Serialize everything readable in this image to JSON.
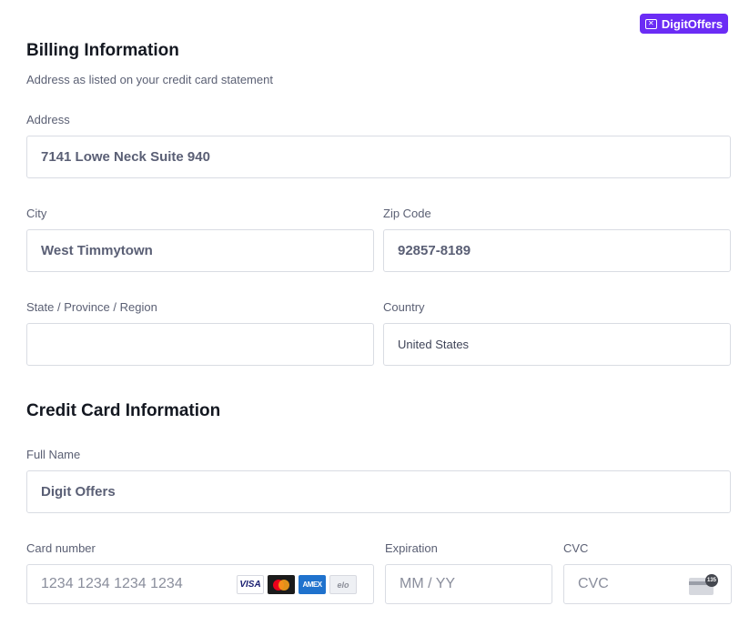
{
  "brand": {
    "name": "DigitOffers",
    "icon": "ticket-icon",
    "color": "#6b2cf5"
  },
  "billing": {
    "title": "Billing Information",
    "subtitle": "Address as listed on your credit card statement",
    "address": {
      "label": "Address",
      "value": "7141 Lowe Neck Suite 940"
    },
    "city": {
      "label": "City",
      "value": "West Timmytown"
    },
    "zip": {
      "label": "Zip Code",
      "value": "92857-8189"
    },
    "state": {
      "label": "State / Province / Region",
      "value": ""
    },
    "country": {
      "label": "Country",
      "value": "United States"
    }
  },
  "card": {
    "title": "Credit Card Information",
    "full_name": {
      "label": "Full Name",
      "value": "Digit Offers"
    },
    "number": {
      "label": "Card number",
      "placeholder": "1234 1234 1234 1234"
    },
    "expiration": {
      "label": "Expiration",
      "placeholder": "MM / YY"
    },
    "cvc": {
      "label": "CVC",
      "placeholder": "CVC",
      "icon_badge": "135"
    },
    "logos": {
      "visa": "VISA",
      "amex": "AMEX",
      "elo": "elo"
    }
  }
}
